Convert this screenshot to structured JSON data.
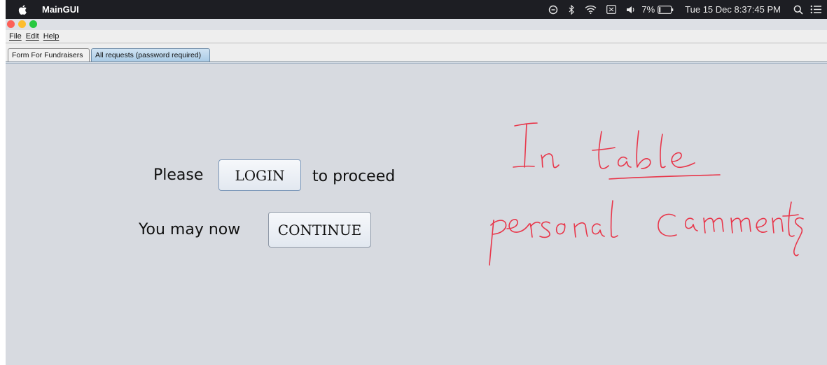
{
  "menubar": {
    "app_name": "MainGUI",
    "battery": "7%",
    "datetime": "Tue 15 Dec  8:37:45 PM"
  },
  "app_menu": {
    "file": "File",
    "edit": "Edit",
    "help": "Help"
  },
  "tabs": [
    {
      "label": "Form For Fundraisers",
      "selected": false
    },
    {
      "label": "All requests (password required)",
      "selected": true
    }
  ],
  "main": {
    "please_text": "Please",
    "login_button": "LOGIN",
    "proceed_text": "to proceed",
    "may_now_text": "You may now",
    "continue_button": "CONTINUE"
  },
  "annotation": {
    "line1": "In table",
    "line2": "personal comments",
    "color": "#e8364a"
  }
}
